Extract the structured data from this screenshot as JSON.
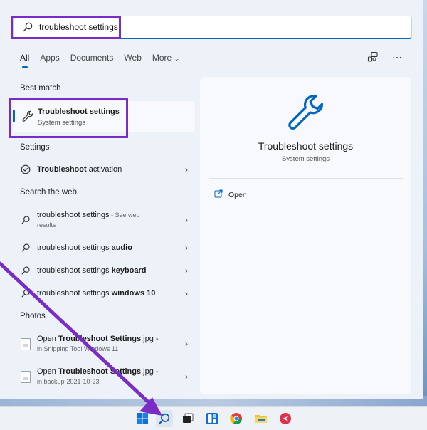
{
  "search": {
    "value": "troubleshoot settings",
    "icon": "search-icon"
  },
  "tabs": [
    {
      "label": "All"
    },
    {
      "label": "Apps"
    },
    {
      "label": "Documents"
    },
    {
      "label": "Web"
    },
    {
      "label": "More"
    }
  ],
  "sections": {
    "best_match": "Best match",
    "settings": "Settings",
    "search_web": "Search the web",
    "photos": "Photos"
  },
  "best_match": {
    "title": "Troubleshoot settings",
    "subtitle": "System settings"
  },
  "settings_items": [
    {
      "bold": "Troubleshoot",
      "rest": " activation"
    }
  ],
  "web_items": [
    {
      "plain": "troubleshoot settings",
      "bold": "",
      "suffix": " - See web",
      "sub": "results"
    },
    {
      "plain": "troubleshoot settings ",
      "bold": "audio",
      "suffix": "",
      "sub": ""
    },
    {
      "plain": "troubleshoot settings ",
      "bold": "keyboard",
      "suffix": "",
      "sub": ""
    },
    {
      "plain": "troubleshoot settings ",
      "bold": "windows 10",
      "suffix": "",
      "sub": ""
    }
  ],
  "photo_items": [
    {
      "pre": "Open ",
      "bold": "Troubleshoot Settings",
      "post": ".jpg -",
      "sub": "in Snipping Tool Windows 11"
    },
    {
      "pre": "Open ",
      "bold": "Troubleshoot Settings",
      "post": ".jpg -",
      "sub": "in backup-2021-10-23"
    }
  ],
  "preview": {
    "title": "Troubleshoot settings",
    "subtitle": "System settings",
    "open_label": "Open"
  },
  "colors": {
    "accent": "#0067c0",
    "highlight": "#7a2cc6"
  }
}
